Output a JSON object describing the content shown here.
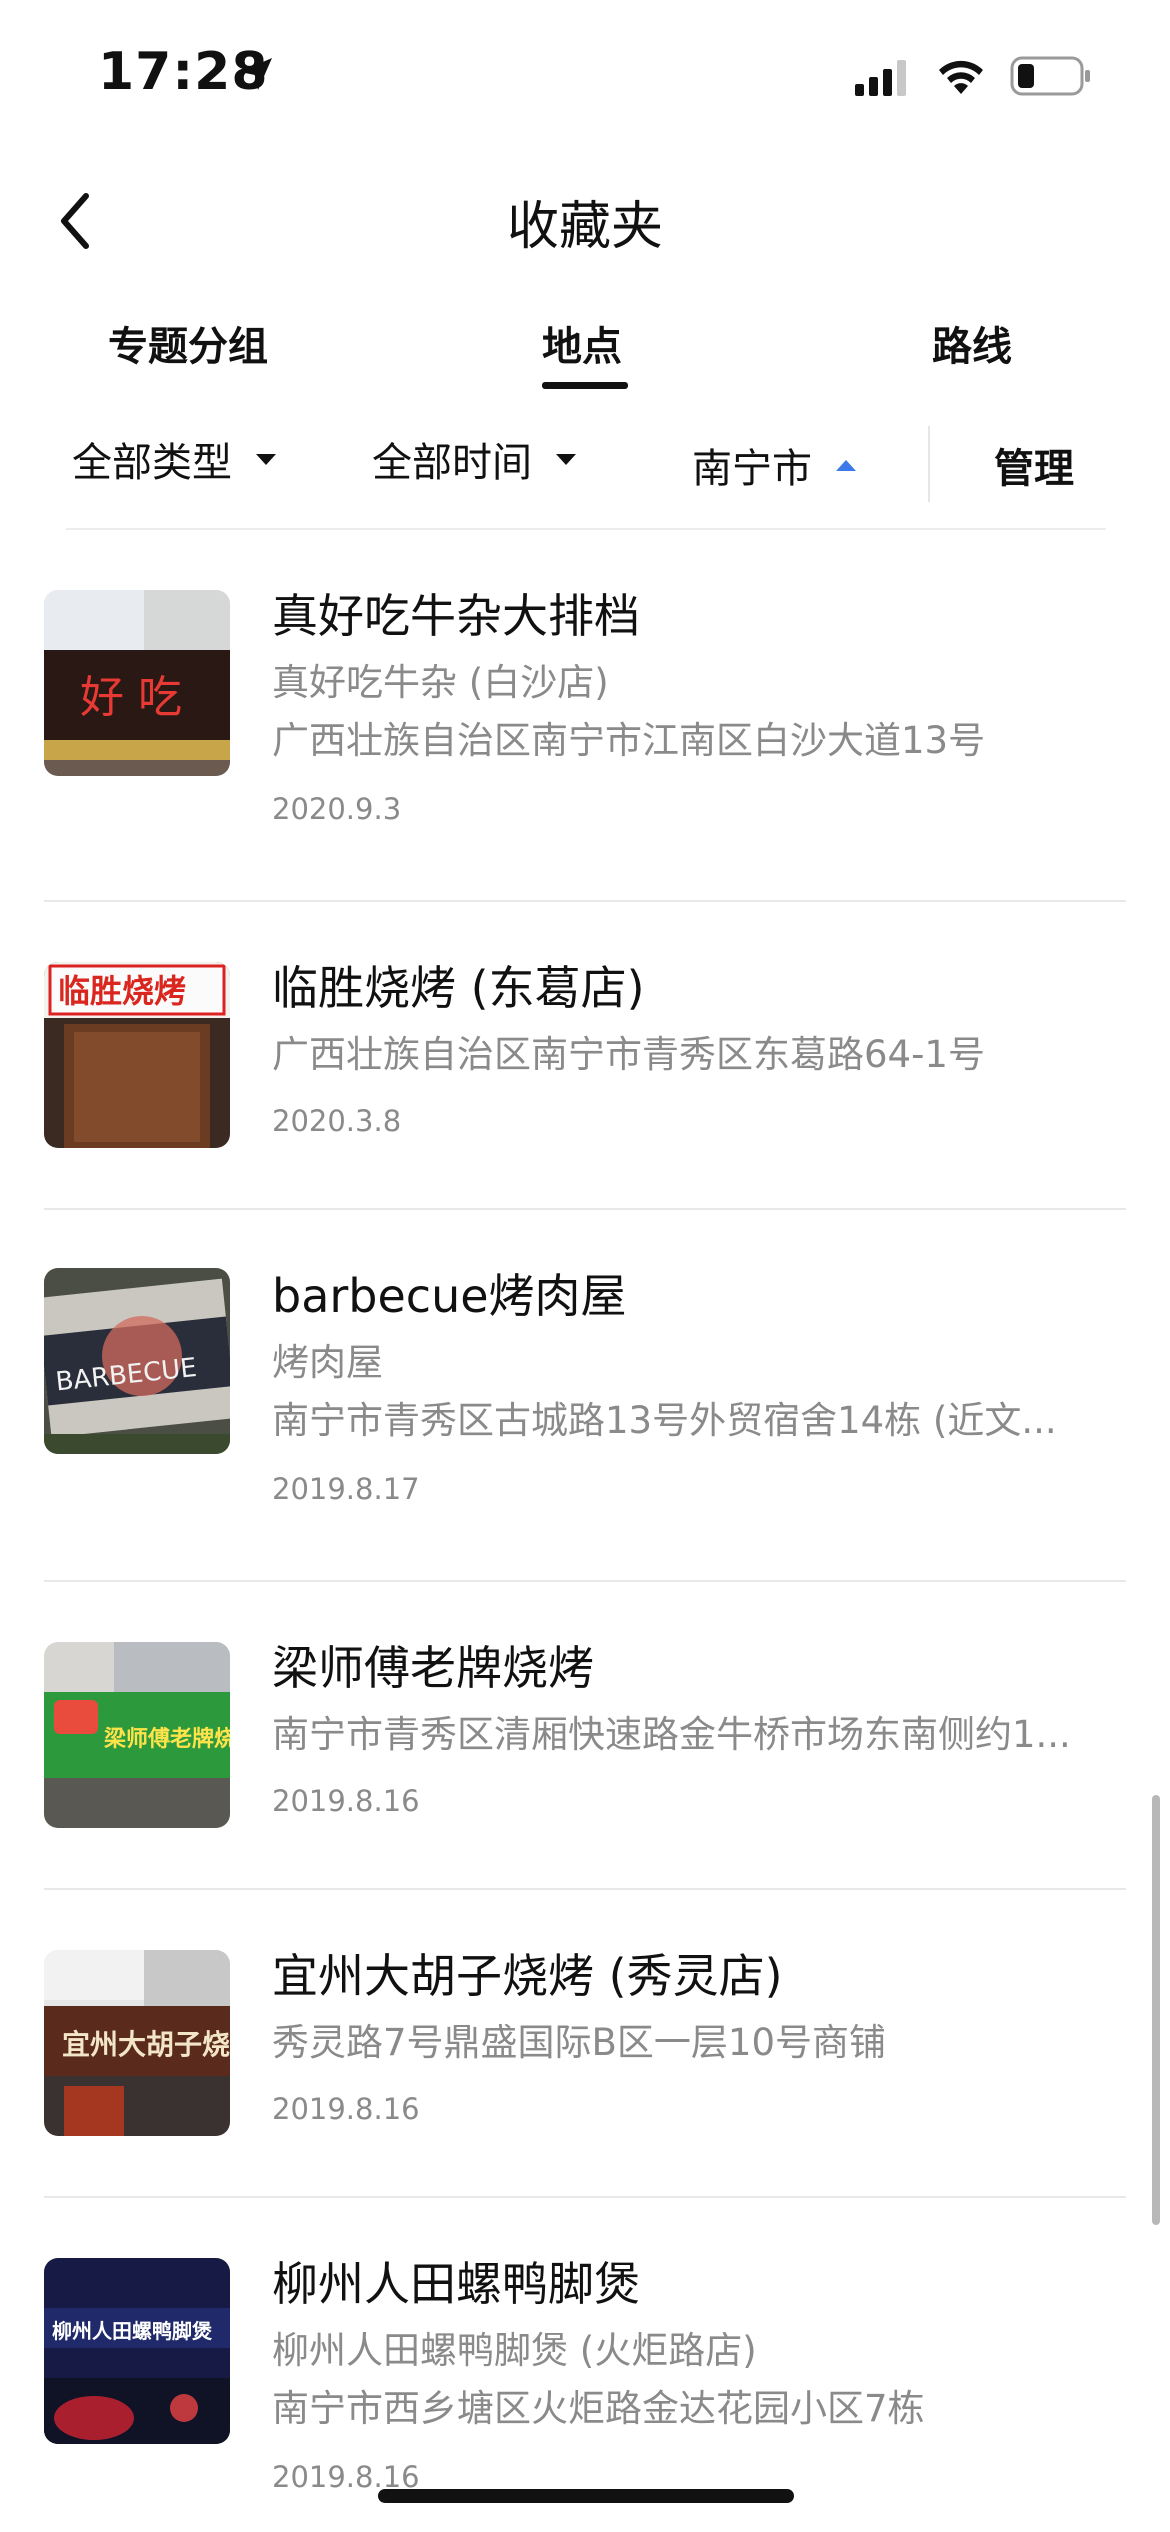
{
  "status_bar": {
    "time": "17:28"
  },
  "nav": {
    "title": "收藏夹"
  },
  "tabs": [
    {
      "label": "专题分组",
      "selected": false
    },
    {
      "label": "地点",
      "selected": true
    },
    {
      "label": "路线",
      "selected": false
    }
  ],
  "filters": {
    "type": "全部类型",
    "time": "全部时间",
    "city": "南宁市",
    "manage": "管理"
  },
  "colors": {
    "accent_blue": "#3b7ae8",
    "secondary_text": "#8a8a8a"
  },
  "places": [
    {
      "name": "真好吃牛杂大排档",
      "subtitle": "真好吃牛杂 (白沙店)",
      "address": "广西壮族自治区南宁市江南区白沙大道13号",
      "date": "2020.9.3",
      "sign_text": "好 吃"
    },
    {
      "name": "临胜烧烤 (东葛店)",
      "subtitle": "",
      "address": "广西壮族自治区南宁市青秀区东葛路64-1号",
      "date": "2020.3.8",
      "sign_text": "临胜烧烤"
    },
    {
      "name": "barbecue烤肉屋",
      "subtitle": "烤肉屋",
      "address": "南宁市青秀区古城路13号外贸宿舍14栋 (近文...",
      "date": "2019.8.17",
      "sign_text": "BARBECUE"
    },
    {
      "name": "梁师傅老牌烧烤",
      "subtitle": "",
      "address": "南宁市青秀区清厢快速路金牛桥市场东南侧约1...",
      "date": "2019.8.16",
      "sign_text": "梁师傅老牌烧烤"
    },
    {
      "name": "宜州大胡子烧烤 (秀灵店)",
      "subtitle": "",
      "address": "秀灵路7号鼎盛国际B区一层10号商铺",
      "date": "2019.8.16",
      "sign_text": "宜州大胡子烧烤"
    },
    {
      "name": "柳州人田螺鸭脚煲",
      "subtitle": "柳州人田螺鸭脚煲 (火炬路店)",
      "address": "南宁市西乡塘区火炬路金达花园小区7栋",
      "date": "2019.8.16",
      "sign_text": "柳州人田螺鸭脚煲"
    }
  ]
}
